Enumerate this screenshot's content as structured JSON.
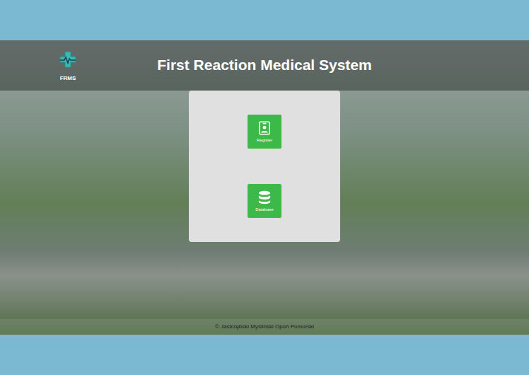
{
  "header": {
    "logo_label": "FRMS",
    "title": "First Reaction Medical System"
  },
  "menu": [
    {
      "label": "Register",
      "kind": "register"
    },
    {
      "label": "Database",
      "kind": "database"
    }
  ],
  "footer": "© Jastrzębski Myśliński Opoń Pomorski"
}
